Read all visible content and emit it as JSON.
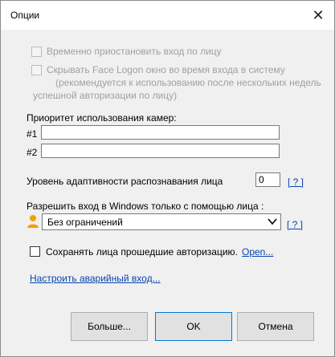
{
  "window": {
    "title": "Опции",
    "close_glyph": "✕"
  },
  "options": {
    "pause_login": "Временно приостановить вход по лицу",
    "hide_window_line1": "Скрывать Face Logon окно во время входа в систему",
    "hide_window_line2": "(рекомендуется к использованию после нескольких недель",
    "hide_window_line3": "успешной авторизации по лицу)"
  },
  "camera": {
    "label": "Приоритет использования камер:",
    "row1": "#1",
    "row2": "#2",
    "value1": "",
    "value2": ""
  },
  "adaptivity": {
    "label": "Уровень адаптивности распознавания лица",
    "value": "0",
    "help": "[ ? ]"
  },
  "windows_login": {
    "label": "Разрешить вход в Windows только с помощью лица :",
    "selected": "Без ограничений",
    "help": "[ ? ]",
    "user_icon": "user-icon"
  },
  "save_faces": {
    "label": "Сохранять лица прошедшие авторизацию.",
    "link": "Open..."
  },
  "emergency_link": "Настроить аварийный вход...",
  "buttons": {
    "more": "Больше...",
    "ok": "OK",
    "cancel": "Отмена"
  }
}
